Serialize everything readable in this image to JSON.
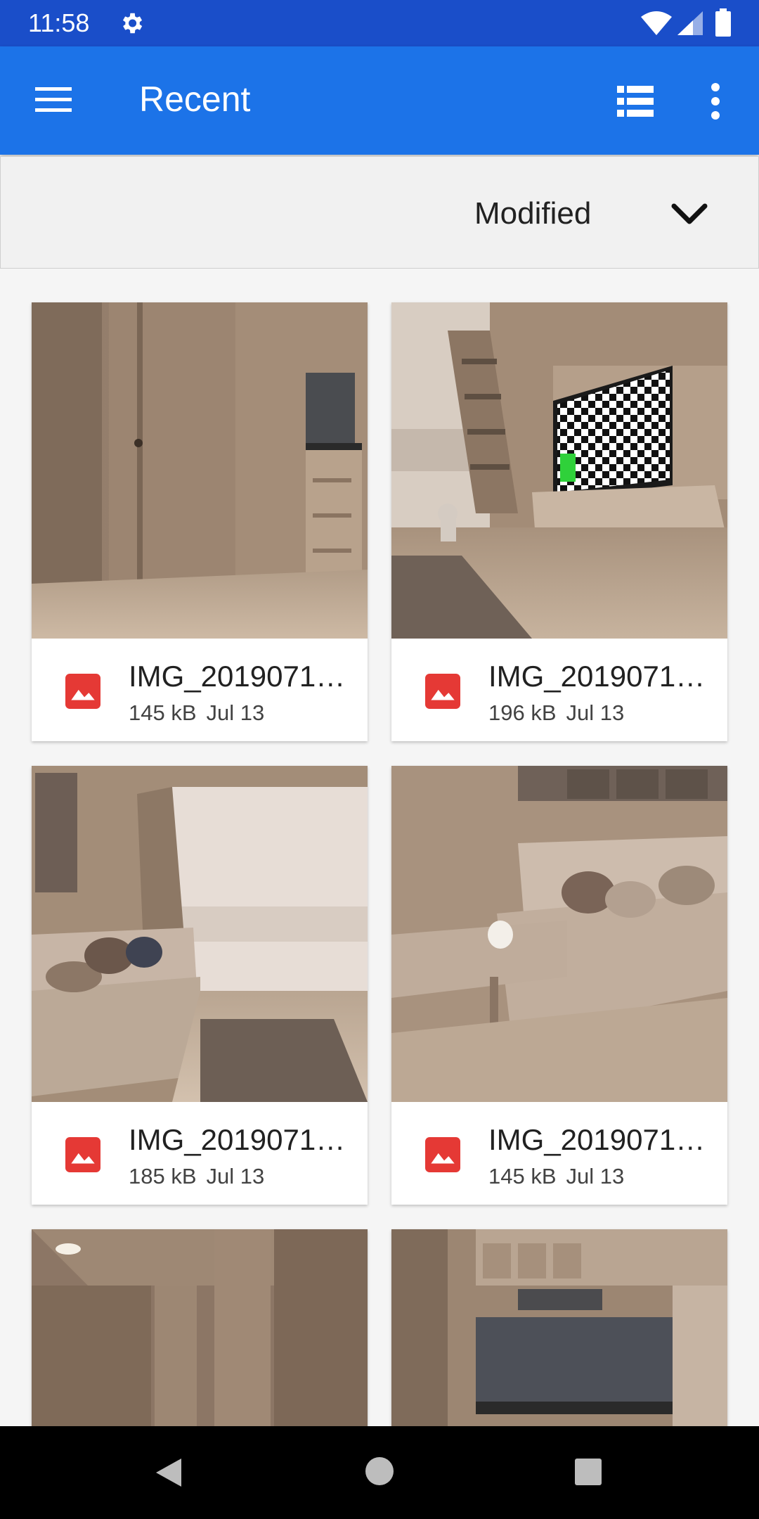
{
  "status_bar": {
    "time": "11:58",
    "icons": [
      "gear-icon",
      "wifi-icon",
      "signal-icon",
      "battery-icon"
    ]
  },
  "app_bar": {
    "title": "Recent",
    "menu_icon": "hamburger-menu-icon",
    "view_icon": "list-view-icon",
    "more_icon": "more-vert-icon",
    "color": "#1c73e8"
  },
  "sort_bar": {
    "label": "Modified",
    "icon": "chevron-down-icon"
  },
  "files": [
    {
      "name": "IMG_2019071…",
      "size": "145 kB",
      "date": "Jul 13",
      "icon": "image-file-icon"
    },
    {
      "name": "IMG_2019071…",
      "size": "196 kB",
      "date": "Jul 13",
      "icon": "image-file-icon"
    },
    {
      "name": "IMG_2019071…",
      "size": "185 kB",
      "date": "Jul 13",
      "icon": "image-file-icon"
    },
    {
      "name": "IMG_2019071…",
      "size": "145 kB",
      "date": "Jul 13",
      "icon": "image-file-icon"
    }
  ],
  "nav_bar": {
    "icons": [
      "back-icon",
      "home-icon",
      "recents-icon"
    ]
  },
  "colors": {
    "status_bar": "#1a4ec9",
    "app_bar": "#1c73e8",
    "file_icon": "#e53935"
  }
}
